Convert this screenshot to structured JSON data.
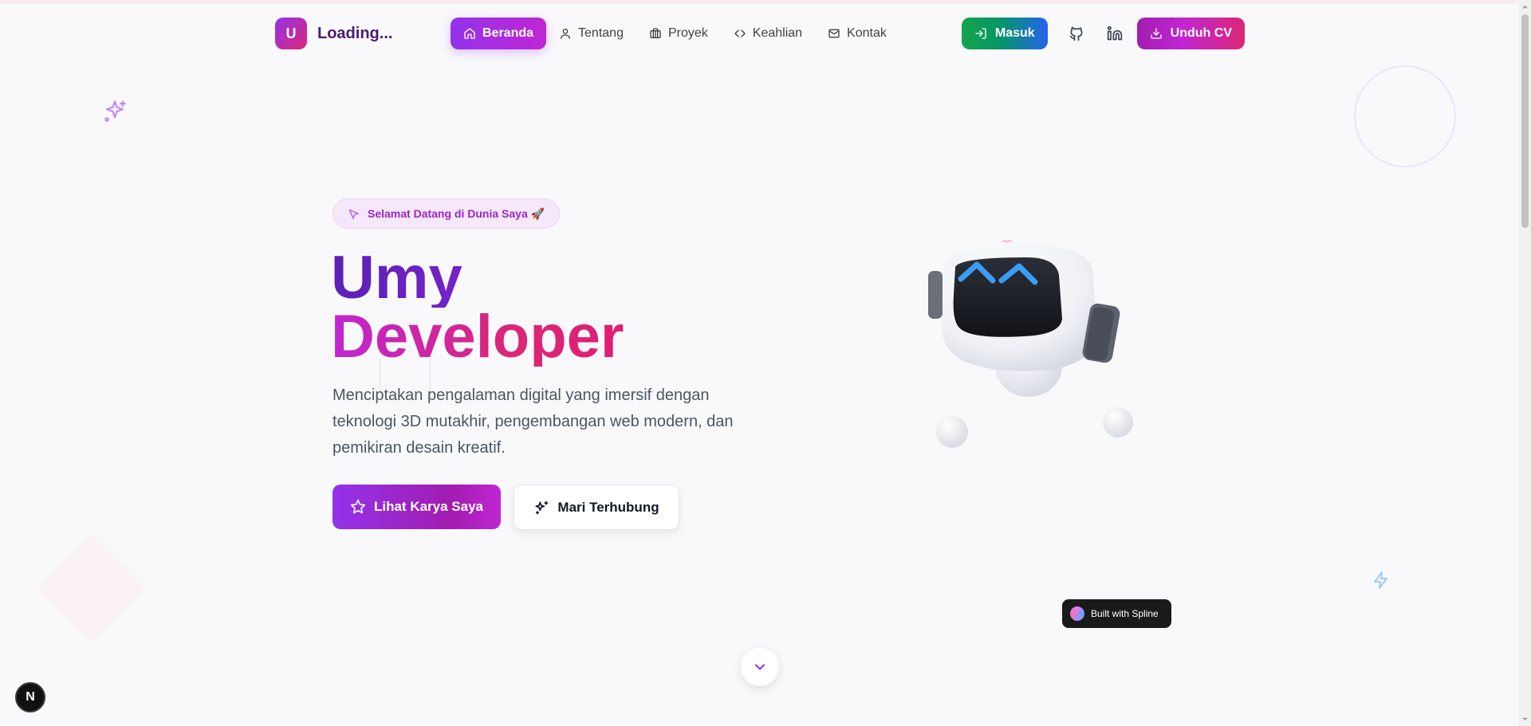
{
  "brand": {
    "logo_letter": "U",
    "title": "Loading..."
  },
  "nav": {
    "items": [
      {
        "label": "Beranda",
        "icon": "home-icon",
        "active": true
      },
      {
        "label": "Tentang",
        "icon": "user-icon"
      },
      {
        "label": "Proyek",
        "icon": "briefcase-icon"
      },
      {
        "label": "Keahlian",
        "icon": "code-icon"
      },
      {
        "label": "Kontak",
        "icon": "mail-icon"
      }
    ],
    "login_label": "Masuk",
    "cv_label": "Unduh CV",
    "github_icon": "github-icon",
    "linkedin_icon": "linkedin-icon"
  },
  "hero": {
    "badge": "Selamat Datang di Dunia Saya 🚀",
    "title_line1": "Umy",
    "title_line2": "Developer",
    "description": "Menciptakan pengalaman digital yang imersif dengan teknologi 3D mutakhir, pengembangan web modern, dan pemikiran desain kreatif.",
    "primary_cta": "Lihat Karya Saya",
    "secondary_cta": "Mari Terhubung"
  },
  "spline_badge": "Built with Spline",
  "next_badge": "N",
  "colors": {
    "accent_purple": "#9333ea",
    "accent_pink": "#db2777",
    "login_green": "#059669",
    "robot_screen": "#1f2937",
    "robot_eyes": "#3b9cf6"
  }
}
